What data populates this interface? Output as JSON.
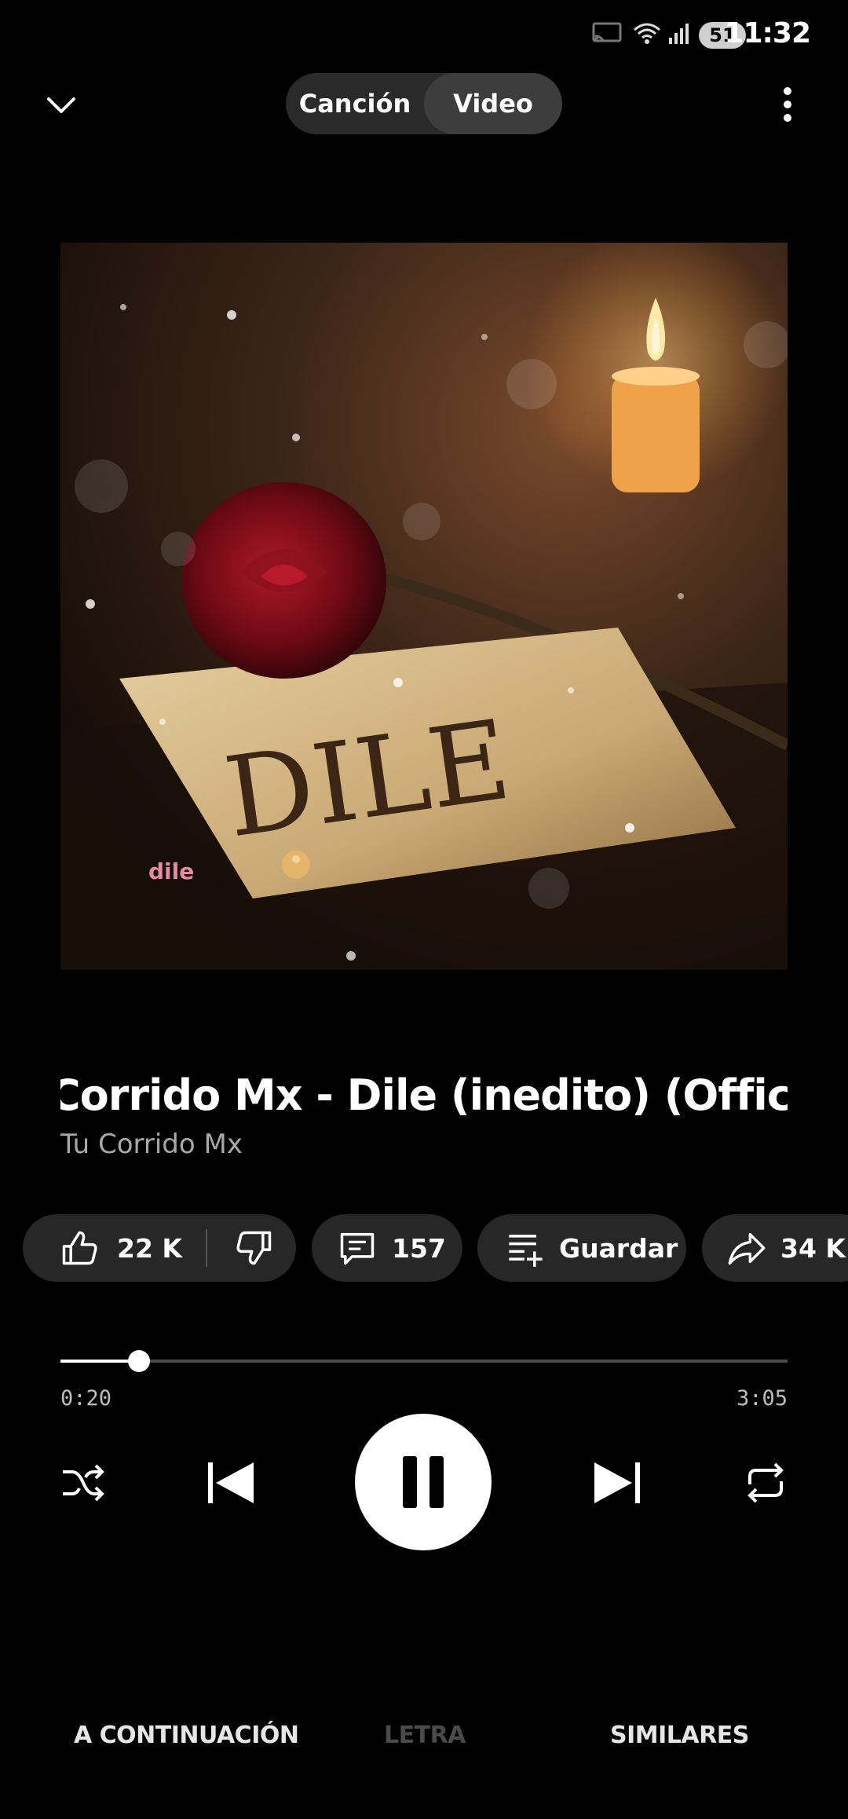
{
  "status_bar": {
    "time": "11:32",
    "battery": "51"
  },
  "header": {
    "tabs": [
      {
        "label": "Canción",
        "active": false
      },
      {
        "label": "Video",
        "active": true
      }
    ]
  },
  "artwork": {
    "card_text": "DILE",
    "watermark": "dile"
  },
  "track": {
    "title": "Corrido Mx - Dile (inedito) (Official Re",
    "artist": "Tu Corrido Mx"
  },
  "actions": {
    "likes": "22 K",
    "comments": "157",
    "save_label": "Guardar",
    "shares": "34 K"
  },
  "progress": {
    "elapsed": "0:20",
    "duration": "3:05",
    "fraction": 0.108
  },
  "bottom_tabs": [
    {
      "label": "A CONTINUACIÓN",
      "active": true
    },
    {
      "label": "LETRA",
      "active": false,
      "disabled": true
    },
    {
      "label": "SIMILARES",
      "active": true
    }
  ],
  "colors": {
    "background": "#000000",
    "chip": "#272727",
    "muted_text": "#a8a8a8",
    "watermark": "#e88aa2"
  }
}
